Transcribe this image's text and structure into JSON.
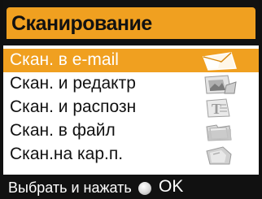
{
  "title": "Сканирование",
  "menu": {
    "items": [
      {
        "label": "Скан. в e-mail",
        "icon": "email-envelope-icon",
        "selected": true
      },
      {
        "label": "Скан. и редактр",
        "icon": "image-edit-icon",
        "selected": false
      },
      {
        "label": "Скан. и распозн",
        "icon": "text-ocr-icon",
        "selected": false
      },
      {
        "label": "Скан. в файл",
        "icon": "folder-file-icon",
        "selected": false
      },
      {
        "label": "Скан.на кар.п.",
        "icon": "memory-card-icon",
        "selected": false
      }
    ]
  },
  "footer": {
    "hint": "Выбрать и нажать",
    "ok_label": "OK",
    "ok_icon": "ok-button-icon"
  },
  "colors": {
    "accent": "#f0a020",
    "frame": "#111111",
    "text": "#111111",
    "selected_text": "#ffffff"
  }
}
